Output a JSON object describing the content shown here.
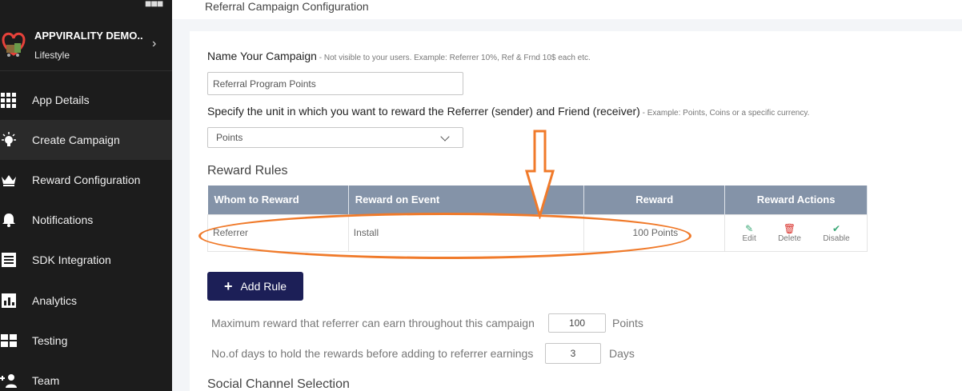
{
  "sidebar": {
    "app_name": "APPVIRALITY DEMO..",
    "app_category": "Lifestyle",
    "items": [
      {
        "label": "App Details",
        "icon": "grid-icon"
      },
      {
        "label": "Create Campaign",
        "icon": "bulb-icon",
        "active": true
      },
      {
        "label": "Reward Configuration",
        "icon": "crown-icon"
      },
      {
        "label": "Notifications",
        "icon": "bell-icon"
      },
      {
        "label": "SDK Integration",
        "icon": "list-icon"
      },
      {
        "label": "Analytics",
        "icon": "bar-chart-icon"
      },
      {
        "label": "Testing",
        "icon": "layout-icon"
      },
      {
        "label": "Team",
        "icon": "add-user-icon"
      }
    ]
  },
  "header": {
    "title": "Referral Campaign Configuration"
  },
  "form": {
    "name_label": "Name Your Campaign",
    "name_hint": " - Not visible to your users. Example: Referrer 10%, Ref & Frnd 10$ each etc.",
    "name_value": "Referral Program Points",
    "unit_label": "Specify the unit in which you want to reward the Referrer (sender) and Friend (receiver)",
    "unit_hint": " - Example: Points, Coins or a specific currency.",
    "unit_value": "Points"
  },
  "rules": {
    "title": "Reward Rules",
    "columns": [
      "Whom to Reward",
      "Reward on Event",
      "Reward",
      "Reward Actions"
    ],
    "rows": [
      {
        "whom": "Referrer",
        "event": "Install",
        "reward": "100 Points"
      }
    ],
    "actions": {
      "edit": "Edit",
      "delete": "Delete",
      "disable": "Disable"
    },
    "add_label": "Add Rule"
  },
  "limits": {
    "max_label": "Maximum reward that referrer can earn throughout this campaign",
    "max_value": "100",
    "max_unit": "Points",
    "hold_label": "No.of days to hold the rewards before adding to referrer earnings",
    "hold_value": "3",
    "hold_unit": "Days"
  },
  "social": {
    "title": "Social Channel Selection"
  },
  "colors": {
    "sidebar": "#1c1c1c",
    "table_header": "#8493a8",
    "button": "#1c1f57",
    "annotation": "#f07a2a"
  }
}
